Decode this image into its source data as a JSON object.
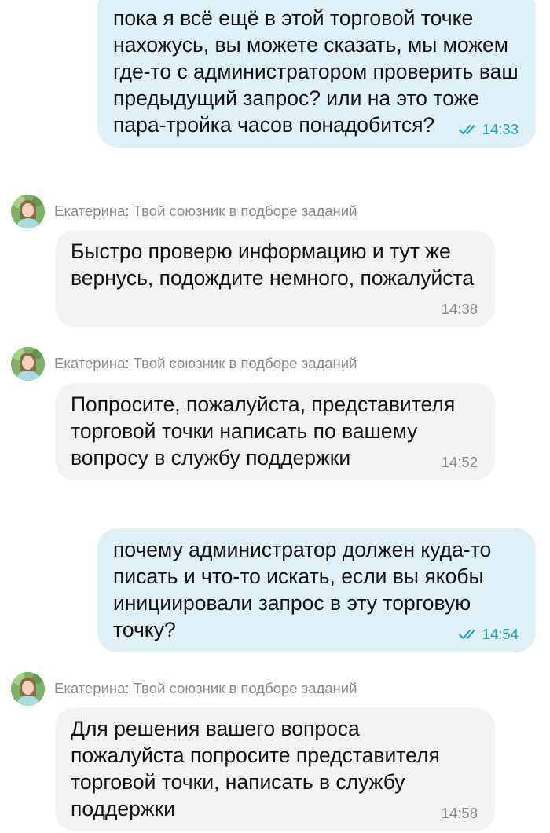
{
  "messages": [
    {
      "direction": "out",
      "text": "пока я всё ещё в этой торговой точке нахожусь, вы можете сказать, мы можем где-то с администратором проверить ваш предыдущий запрос? или на это тоже пара-тройка часов понадобится?",
      "time": "14:33",
      "status_icon": "double-check-icon"
    },
    {
      "direction": "in",
      "sender": "Екатерина: Твой союзник в подборе заданий",
      "text": "Быстро проверю информацию и тут же вернусь, подождите немного, пожалуйста",
      "time": "14:38"
    },
    {
      "direction": "in",
      "sender": "Екатерина: Твой союзник в подборе заданий",
      "text": "Попросите, пожалуйста, представителя торговой точки написать по вашему вопросу в службу поддержки",
      "time": "14:52"
    },
    {
      "direction": "out",
      "text": "почему администратор должен куда-то писать и что-то искать, если вы якобы инициировали запрос в эту торговую точку?",
      "time": "14:54",
      "status_icon": "double-check-icon"
    },
    {
      "direction": "in",
      "sender": "Екатерина: Твой союзник в подборе заданий",
      "text": "Для решения вашего вопроса пожалуйста попросите представителя торговой точки, написать в службу поддержки",
      "time": "14:58"
    }
  ],
  "colors": {
    "outgoing_bubble": "#dff1f7",
    "incoming_bubble": "#f3f3f5",
    "read_status": "#1fa3c4",
    "meta_gray": "#8a8a8d"
  }
}
